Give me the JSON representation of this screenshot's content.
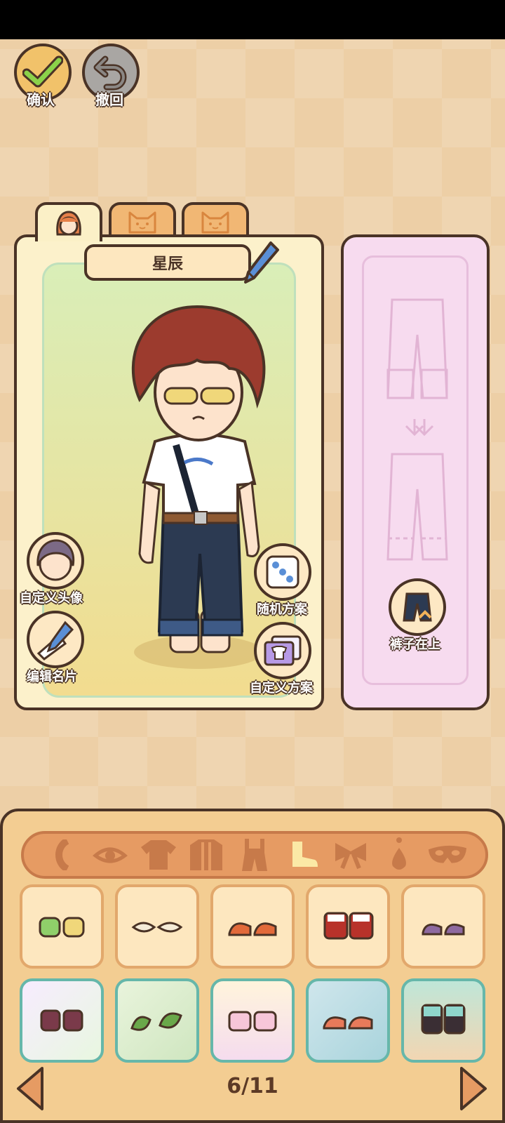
{
  "toolbar": {
    "confirm_label": "确认",
    "undo_label": "撤回"
  },
  "character_tabs": [
    {
      "icon": "girl-face-icon",
      "active": true
    },
    {
      "icon": "cat-face-icon",
      "active": false
    },
    {
      "icon": "cat-face-icon",
      "active": false
    }
  ],
  "character_panel": {
    "name": "星辰",
    "custom_avatar_label": "自定义头像",
    "edit_card_label": "编辑名片",
    "random_outfit_label": "随机方案",
    "custom_outfit_label": "自定义方案"
  },
  "layer_panel": {
    "pants_on_top_label": "裤子在上"
  },
  "categories": [
    {
      "icon": "hair-icon",
      "active": false
    },
    {
      "icon": "eye-icon",
      "active": false
    },
    {
      "icon": "tshirt-icon",
      "active": false
    },
    {
      "icon": "jacket-icon",
      "active": false
    },
    {
      "icon": "overalls-icon",
      "active": false
    },
    {
      "icon": "shoe-icon",
      "active": true
    },
    {
      "icon": "bow-icon",
      "active": false
    },
    {
      "icon": "earring-icon",
      "active": false
    },
    {
      "icon": "mask-icon",
      "active": false
    }
  ],
  "pagination": {
    "current": "6/11"
  },
  "colors": {
    "accent_outline": "#4a3326",
    "panel_cream": "#fcf1cb",
    "layer_pink": "#f7dbef",
    "category_bar": "#e69b63",
    "active_category": "#fbe9a6"
  }
}
